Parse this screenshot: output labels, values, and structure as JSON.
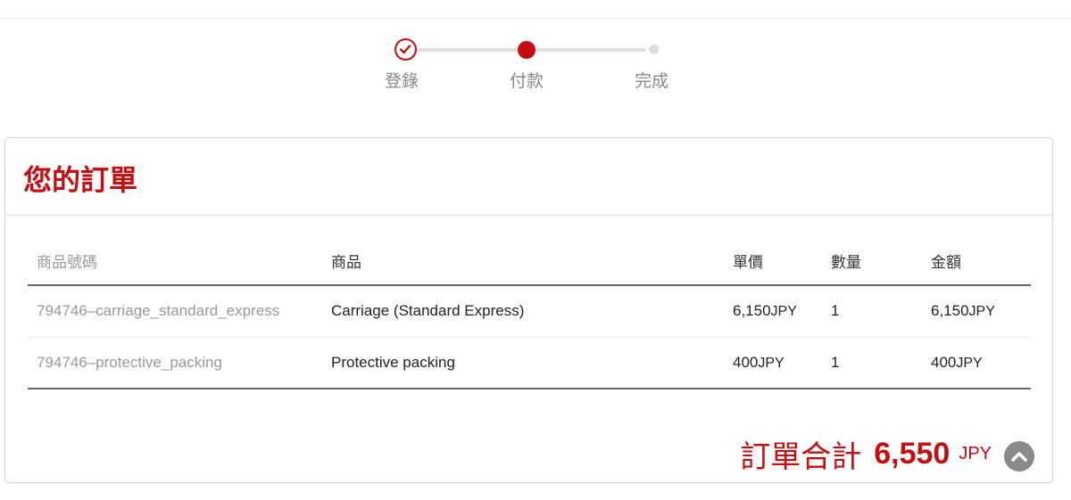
{
  "steps": [
    {
      "label": "登錄",
      "state": "done"
    },
    {
      "label": "付款",
      "state": "current"
    },
    {
      "label": "完成",
      "state": "pending"
    }
  ],
  "order": {
    "title": "您的訂單",
    "columns": {
      "code": "商品號碼",
      "name": "商品",
      "unit_price": "單價",
      "quantity": "數量",
      "amount": "金額"
    },
    "rows": [
      {
        "code": "794746–carriage_standard_express",
        "name": "Carriage (Standard Express)",
        "unit_price": "6,150",
        "unit_currency": "JPY",
        "quantity": "1",
        "amount": "6,150",
        "amount_currency": "JPY"
      },
      {
        "code": "794746–protective_packing",
        "name": "Protective packing",
        "unit_price": "400",
        "unit_currency": "JPY",
        "quantity": "1",
        "amount": "400",
        "amount_currency": "JPY"
      }
    ],
    "total": {
      "label": "訂單合計",
      "value": "6,550",
      "currency": "JPY"
    }
  },
  "colors": {
    "accent": "#c40e12",
    "muted_text": "#999999"
  },
  "icons": {
    "done_step": "checkmark-icon",
    "scroll_top": "chevron-up-icon"
  }
}
